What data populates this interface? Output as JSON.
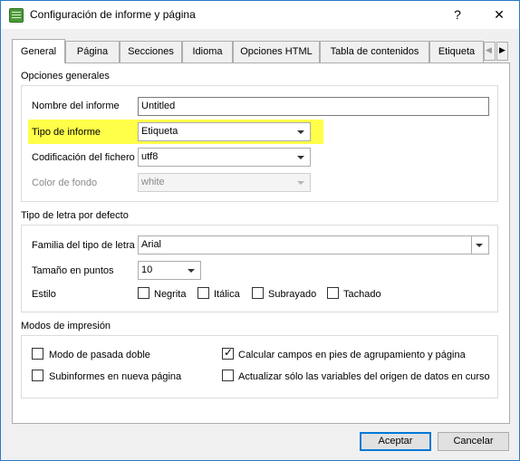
{
  "window": {
    "title": "Configuración de informe y página",
    "help_glyph": "?",
    "close_glyph": "✕"
  },
  "tabs": [
    {
      "label": "General",
      "active": true
    },
    {
      "label": "Página"
    },
    {
      "label": "Secciones"
    },
    {
      "label": "Idioma"
    },
    {
      "label": "Opciones HTML"
    },
    {
      "label": "Tabla de contenidos"
    },
    {
      "label": "Etiqueta"
    }
  ],
  "tab_scroll": {
    "left": "◀",
    "right": "▶"
  },
  "general_options": {
    "section_title": "Opciones generales",
    "report_name_label": "Nombre del informe",
    "report_name_value": "Untitled",
    "report_type_label": "Tipo de informe",
    "report_type_value": "Etiqueta",
    "encoding_label": "Codificación del fichero",
    "encoding_value": "utf8",
    "background_label": "Color de fondo",
    "background_value": "white"
  },
  "default_font": {
    "section_title": "Tipo de letra por defecto",
    "family_label": "Familia del tipo de letra",
    "family_value": "Arial",
    "size_label": "Tamaño en puntos",
    "size_value": "10",
    "style_label": "Estilo",
    "bold_label": "Negrita",
    "italic_label": "Itálica",
    "underline_label": "Subrayado",
    "strike_label": "Tachado"
  },
  "print_modes": {
    "section_title": "Modos de impresión",
    "double_pass_label": "Modo de pasada doble",
    "double_pass_checked": false,
    "subreports_label": "Subinformes en nueva página",
    "subreports_checked": false,
    "calc_footers_label": "Calcular campos en pies de agrupamiento y página",
    "calc_footers_checked": true,
    "update_vars_label": "Actualizar sólo las variables del origen de datos en curso",
    "update_vars_checked": false
  },
  "footer": {
    "accept_label": "Aceptar",
    "cancel_label": "Cancelar"
  },
  "colors": {
    "highlight": "#ffff4a",
    "accent": "#0078d7"
  }
}
